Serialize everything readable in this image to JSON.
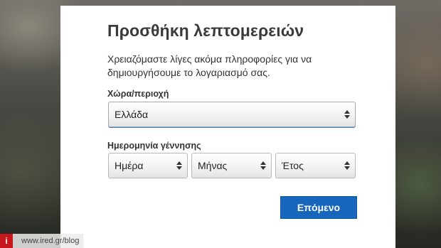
{
  "form": {
    "title": "Προσθήκη λεπτομερειών",
    "subtitle": "Χρειαζόμαστε λίγες ακόμα πληροφορίες για να δημιουργήσουμε το λογαριασμό σας.",
    "country_label": "Χώρα/περιοχή",
    "country_value": "Ελλάδα",
    "birthdate_label": "Ημερομηνία γέννησης",
    "day_value": "Ημέρα",
    "month_value": "Μήνας",
    "year_value": "Έτος",
    "next_button": "Επόμενο"
  },
  "watermark": {
    "badge": "i",
    "text": "www.ired.gr/blog"
  },
  "colors": {
    "accent": "#1666bb",
    "watermark_red": "#c7161c"
  }
}
